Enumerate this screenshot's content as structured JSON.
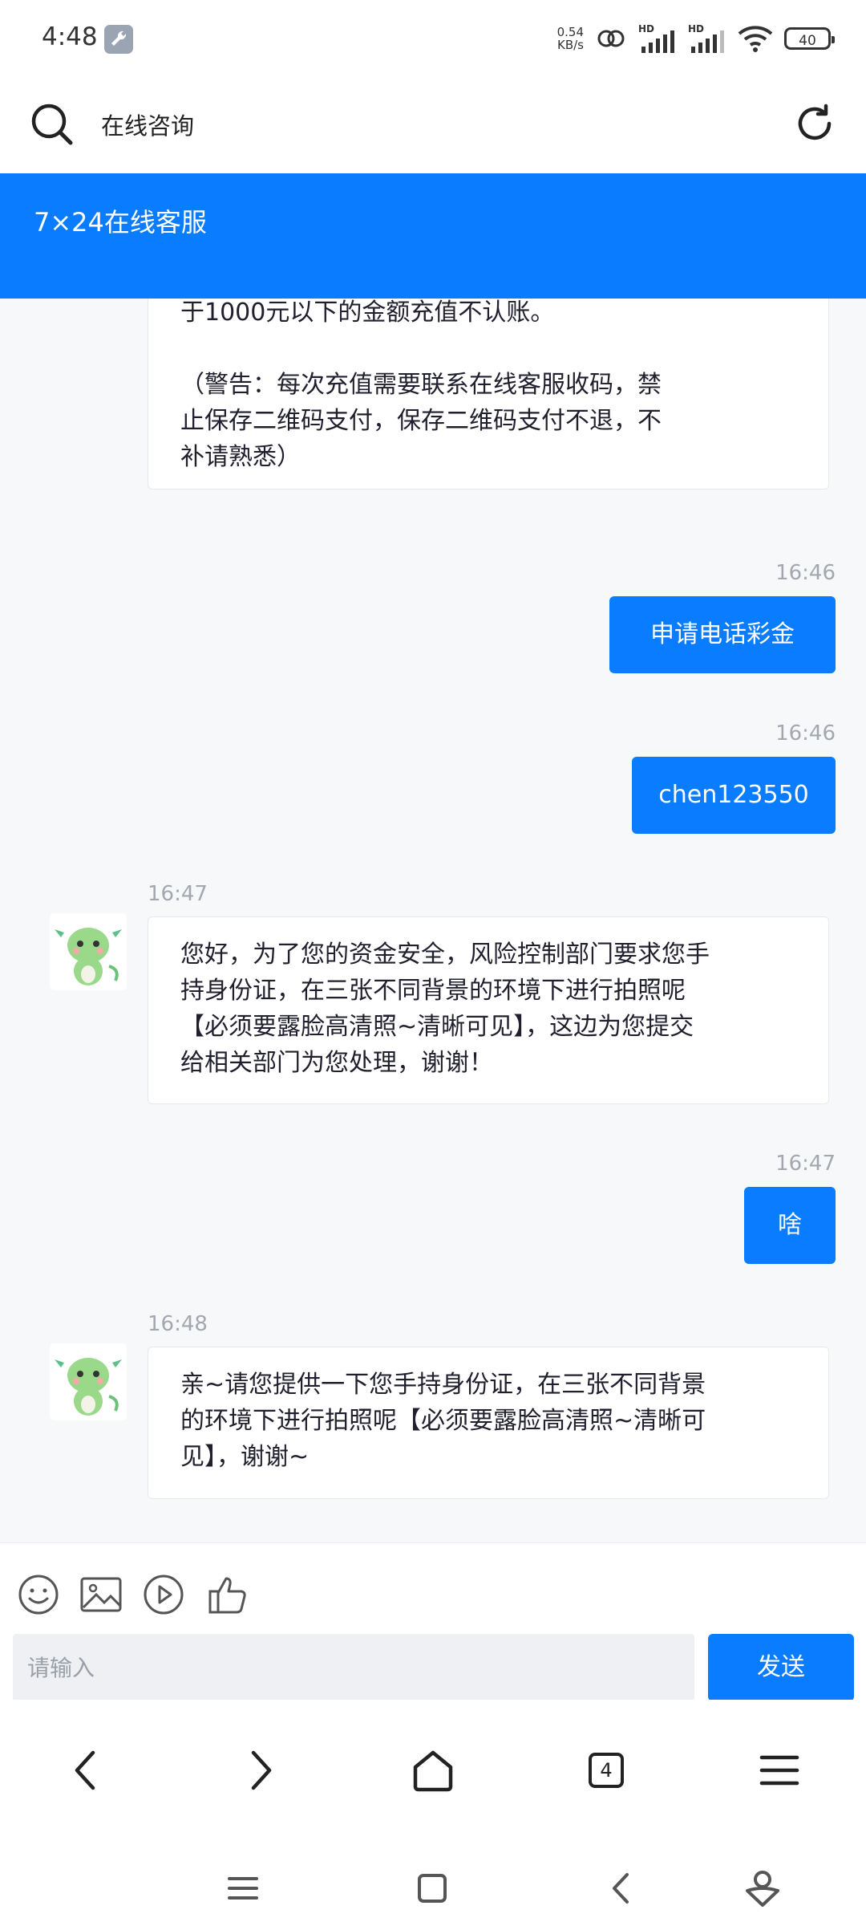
{
  "status_bar": {
    "time": "4:48",
    "net_speed_value": "0.54",
    "net_speed_unit": "KB/s",
    "battery": "40"
  },
  "url_bar": {
    "text": "在线咨询"
  },
  "header": {
    "title": "7×24在线客服"
  },
  "messages": {
    "m0": {
      "text_lines": [
        "于1000元以下的金额充值不认账。",
        "",
        "（警告：每次充值需要联系在线客服收码，禁",
        "止保存二维码支付，保存二维码支付不退，不",
        "补请熟悉）"
      ]
    },
    "m1": {
      "time": "16:46",
      "text": "申请电话彩金"
    },
    "m2": {
      "time": "16:46",
      "text": "chen123550"
    },
    "m3": {
      "time": "16:47",
      "text_lines": [
        "您好，为了您的资金安全，风险控制部门要求您手",
        "持身份证，在三张不同背景的环境下进行拍照呢",
        "【必须要露脸高清照~清晰可见】，这边为您提交",
        "给相关部门为您处理，谢谢！"
      ]
    },
    "m4": {
      "time": "16:47",
      "text": "啥"
    },
    "m5": {
      "time": "16:48",
      "text_lines": [
        "亲~请您提供一下您手持身份证，在三张不同背景",
        "的环境下进行拍照呢【必须要露脸高清照~清晰可",
        "见】，谢谢~"
      ]
    }
  },
  "composer": {
    "placeholder": "请输入",
    "send_label": "发送"
  },
  "browser_nav": {
    "tabs_count": "4"
  },
  "colors": {
    "accent": "#0a7cff",
    "background": "#f7f8fa"
  }
}
